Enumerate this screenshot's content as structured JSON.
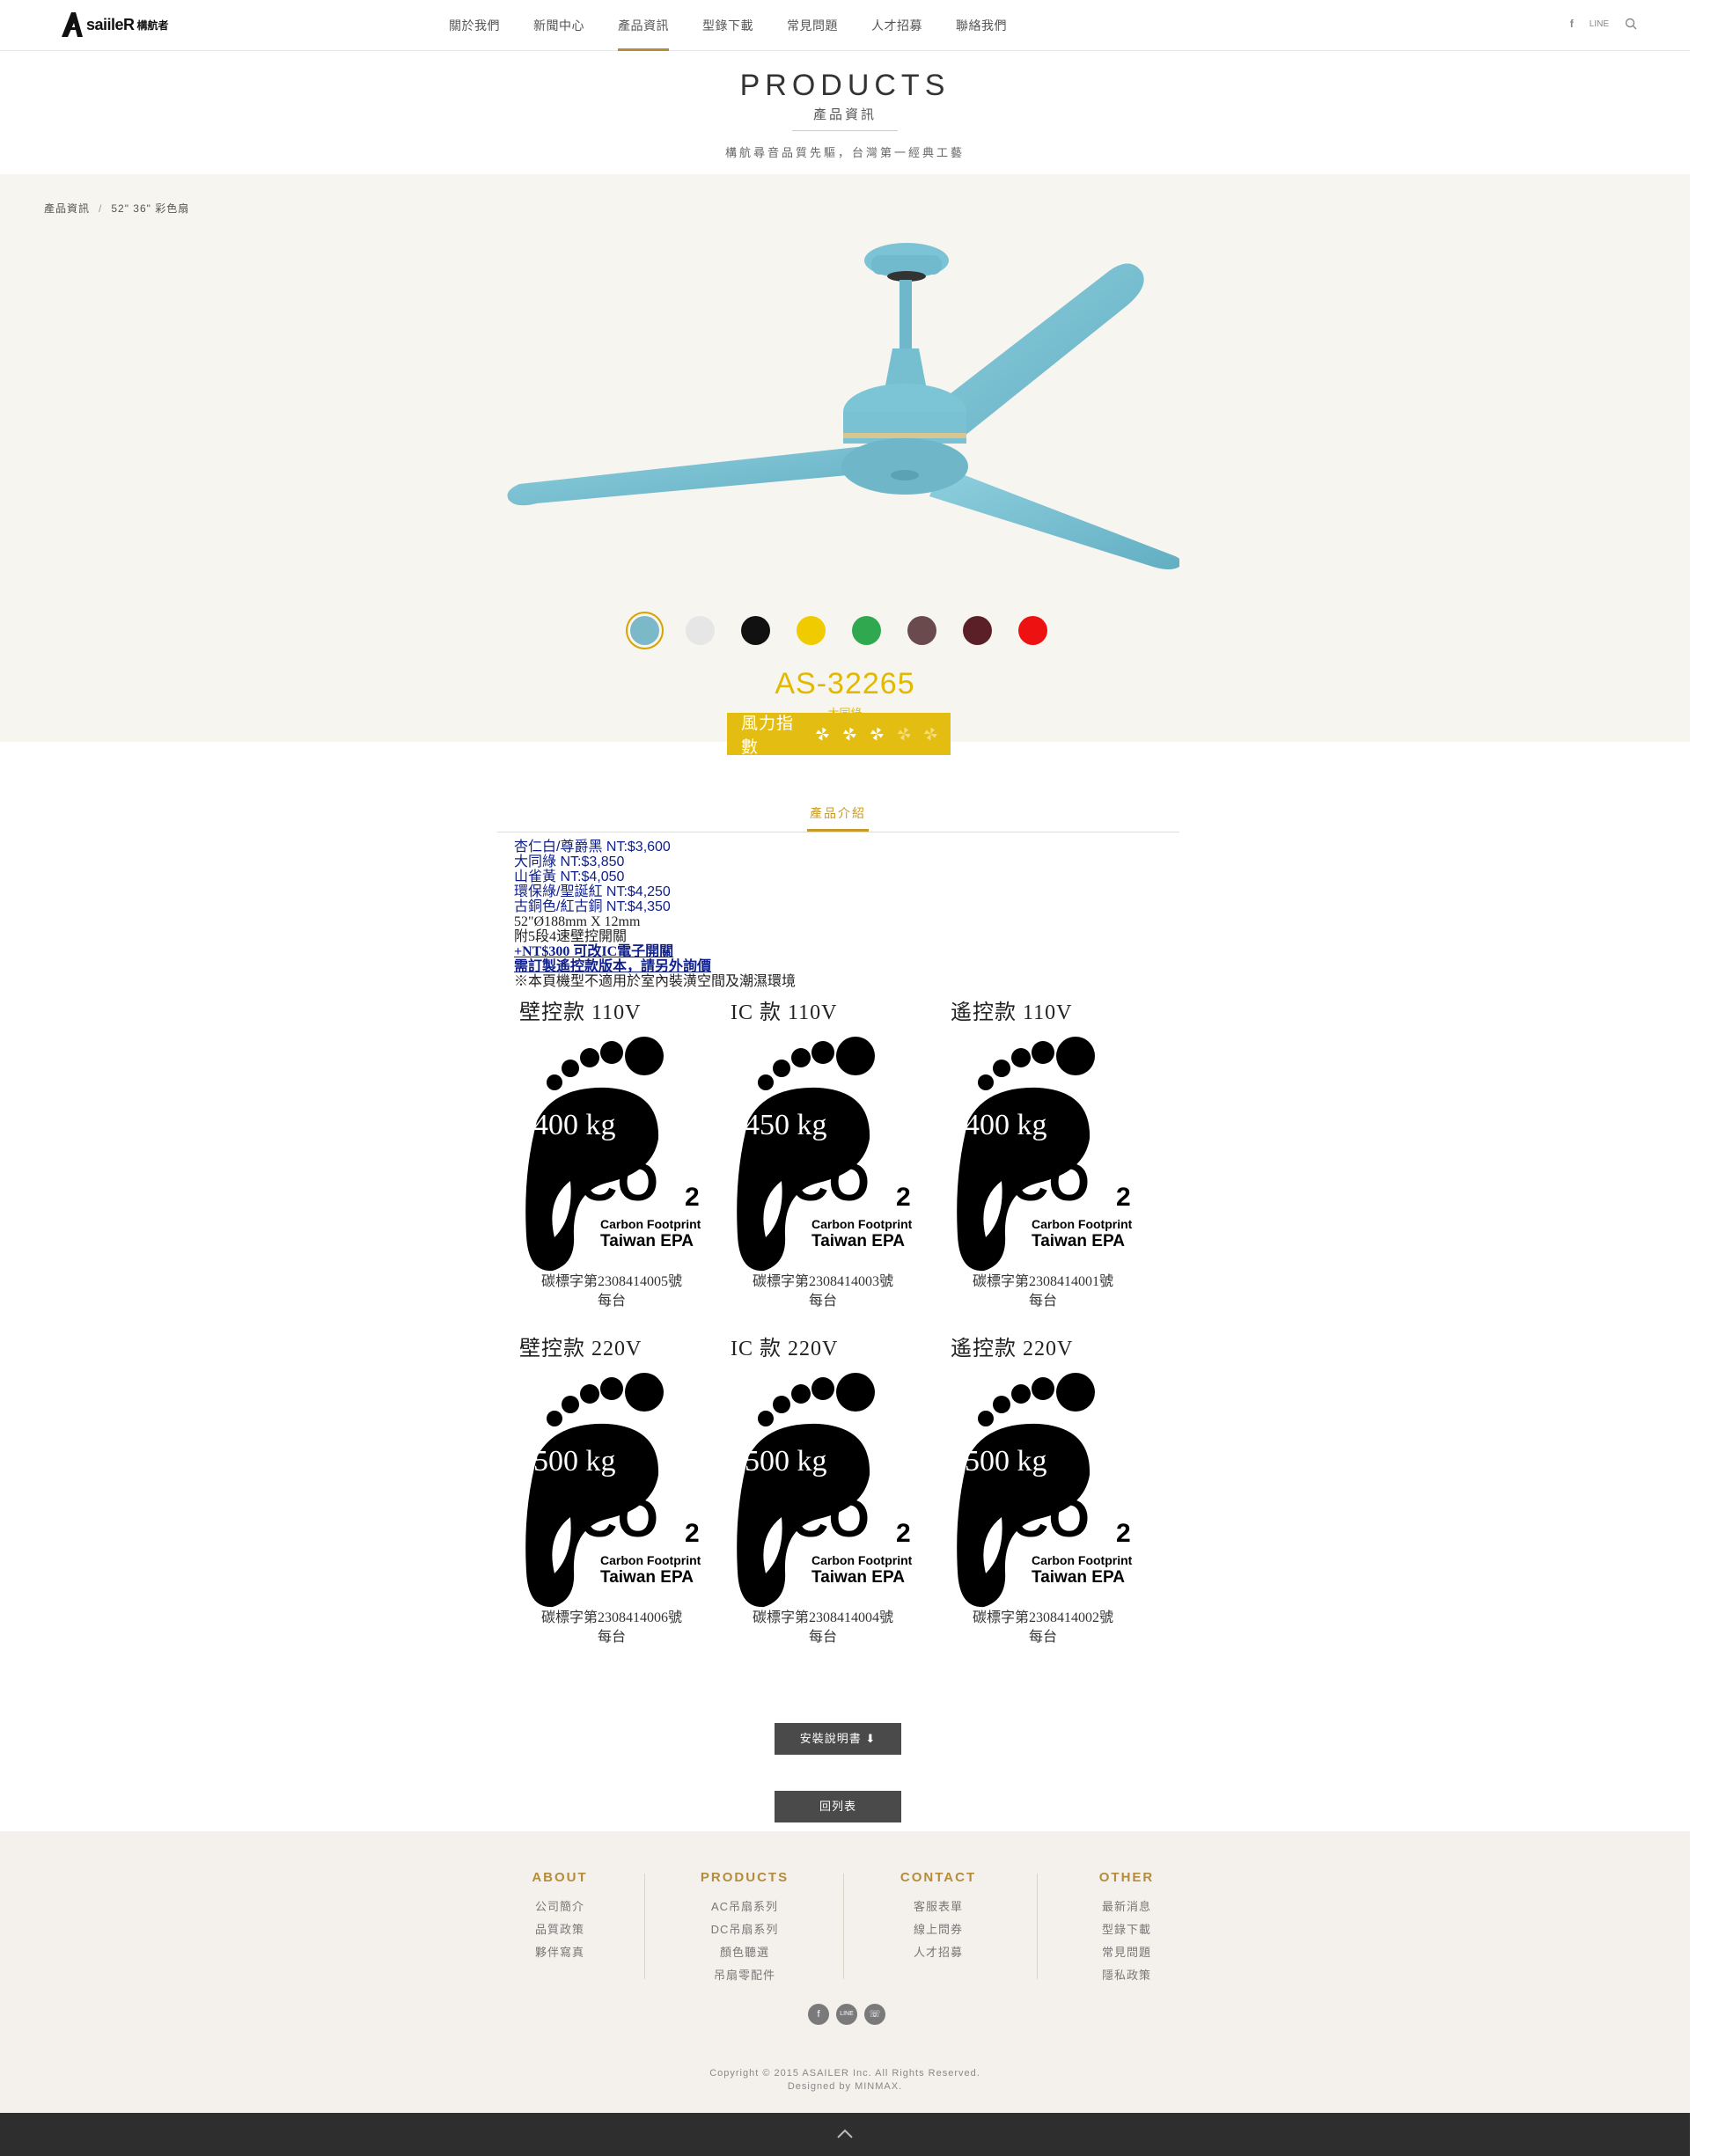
{
  "header": {
    "logo_text": "saiileR",
    "logo_cn": "構航者",
    "nav": [
      "關於我們",
      "新聞中心",
      "產品資訊",
      "型錄下載",
      "常見問題",
      "人才招募",
      "聯絡我們"
    ],
    "line_label": "LINE"
  },
  "title": {
    "en": "PRODUCTS",
    "cn": "產品資訊",
    "sub": "構航尋音品質先驅，台灣第一經典工藝"
  },
  "breadcrumb": {
    "root": "產品資訊",
    "current": "52\" 36\" 彩色扇"
  },
  "swatches": [
    "#7bb8c8",
    "#e6e6e6",
    "#111111",
    "#f0cb00",
    "#2fa84f",
    "#6b4a4e",
    "#5a1f27",
    "#ee1111"
  ],
  "product": {
    "model": "AS-32265",
    "color_name": "大同綠",
    "wind_label": "風力指數"
  },
  "tab": {
    "label": "產品介紹"
  },
  "intro": {
    "lines_blue": [
      "杏仁白/尊爵黑 NT:$3,600",
      "大同綠 NT:$3,850",
      "山雀黃 NT:$4,050",
      "環保綠/聖誕紅 NT:$4,250",
      "古銅色/紅古銅 NT:$4,350"
    ],
    "spec": "52\"Ø188mm X 12mm",
    "switch": "附5段4速壁控開關",
    "ic_option": "+NT$300 可改IC電子開關",
    "custom": "需訂製遙控款版本，請另外詢價",
    "note": "※本頁機型不適用於室內裝潢空間及潮濕環境"
  },
  "carbon_labels": [
    {
      "title": "壁控款 110V",
      "kg": "400 kg",
      "cert": "碳標字第2308414005號",
      "unit": "每台"
    },
    {
      "title": "IC 款 110V",
      "kg": "450 kg",
      "cert": "碳標字第2308414003號",
      "unit": "每台"
    },
    {
      "title": "遙控款 110V",
      "kg": "400 kg",
      "cert": "碳標字第2308414001號",
      "unit": "每台"
    },
    {
      "title": "壁控款 220V",
      "kg": "500 kg",
      "cert": "碳標字第2308414006號",
      "unit": "每台"
    },
    {
      "title": "IC 款 220V",
      "kg": "500 kg",
      "cert": "碳標字第2308414004號",
      "unit": "每台"
    },
    {
      "title": "遙控款 220V",
      "kg": "500 kg",
      "cert": "碳標字第2308414002號",
      "unit": "每台"
    }
  ],
  "co2": {
    "mark": "CO",
    "sub": "2",
    "line1": "Carbon Footprint",
    "line2": "Taiwan EPA"
  },
  "buttons": {
    "manual": "安裝說明書 ⬇",
    "back": "回列表"
  },
  "footer": {
    "about": {
      "head": "ABOUT",
      "links": [
        "公司簡介",
        "品質政策",
        "夥伴寫真"
      ]
    },
    "products": {
      "head": "PRODUCTS",
      "links": [
        "AC吊扇系列",
        "DC吊扇系列",
        "顏色聽選",
        "吊扇零配件"
      ]
    },
    "contact": {
      "head": "CONTACT",
      "links": [
        "客服表單",
        "線上問券",
        "人才招募"
      ]
    },
    "other": {
      "head": "OTHER",
      "links": [
        "最新消息",
        "型錄下載",
        "常見問題",
        "隱私政策"
      ]
    },
    "copyright": "Copyright © 2015 ASAILER Inc. All Rights Reserved.",
    "designed": "Designed by MINMAX.",
    "social": [
      "f",
      "LINE",
      "☏"
    ]
  }
}
